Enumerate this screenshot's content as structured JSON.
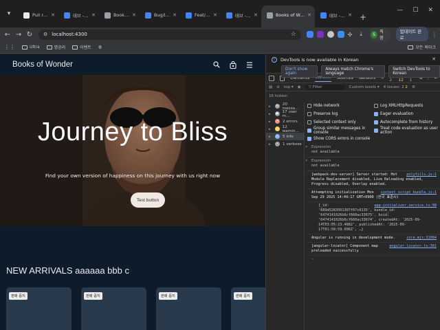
{
  "browser": {
    "tabs": [
      {
        "title": "Pull requests ·",
        "favicon_color": "#e8eaed",
        "active": false
      },
      {
        "title": "태브 - Tesso",
        "favicon_color": "#4285f4",
        "active": false
      },
      {
        "title": "Books of Wond",
        "favicon_color": "#9aa0a6",
        "active": false
      },
      {
        "title": "Bug/Issue Track",
        "favicon_color": "#4285f4",
        "active": false
      },
      {
        "title": "Feat/bens cova",
        "favicon_color": "#4285f4",
        "active": false
      },
      {
        "title": "태브 - Tesso",
        "favicon_color": "#4285f4",
        "active": false
      },
      {
        "title": "Books of Wond",
        "favicon_color": "#9aa0a6",
        "active": true
      },
      {
        "title": "태브 - Tesso",
        "favicon_color": "#4285f4",
        "active": false
      }
    ],
    "url": "localhost:4300",
    "profile_name": "직장",
    "update_label": "업데이트 완료",
    "bookmarks": [
      {
        "label": "Ultra",
        "type": "folder"
      },
      {
        "label": "명공리",
        "type": "folder"
      },
      {
        "label": "이벤트",
        "type": "folder"
      },
      {
        "label": "",
        "type": "globe"
      }
    ],
    "bookmarks_all": "모든 북마크"
  },
  "site": {
    "brand": "Books of Wonder",
    "hero": {
      "title": "Journey to Bliss",
      "subtitle": "Find your own version of happiness on this journey with us right now",
      "button": "Test button"
    },
    "section_title": "NEW ARRIVALS aaaaaa bbb c",
    "cards": [
      {
        "badge": "판매 중지"
      },
      {
        "badge": "판매 중지"
      },
      {
        "badge": "판매 중지"
      },
      {
        "badge": "판매 중지"
      }
    ]
  },
  "devtools": {
    "banner": "DevTools is now available in Korean",
    "banner_buttons": [
      "Don't show again",
      "Always match Chrome's language",
      "Switch DevTools to Korean"
    ],
    "tabs": [
      "Elements",
      "Console",
      "Sources",
      "Network"
    ],
    "active_tab": "Console",
    "counts": {
      "errors": "2",
      "warnings": "12",
      "info": "1"
    },
    "top_label": "top",
    "filter_placeholder": "Filter",
    "levels_label": "Custom levels",
    "issues_label": "4 Issues:",
    "issues_errors": "2",
    "issues_warnings": "2",
    "hidden_label": "16 hidden",
    "sidebar": [
      {
        "label": "20 messa…",
        "icon": "list",
        "color": "#9aa0a6",
        "selected": false
      },
      {
        "label": "17 user m…",
        "icon": "user",
        "color": "#9aa0a6",
        "selected": false
      },
      {
        "label": "2 errors",
        "icon": "error",
        "color": "#f28b82",
        "selected": false
      },
      {
        "label": "12 warnin…",
        "icon": "warning",
        "color": "#fdd663",
        "selected": false
      },
      {
        "label": "5 info",
        "icon": "info",
        "color": "#8ab4f8",
        "selected": true
      },
      {
        "label": "1 verbose",
        "icon": "verbose",
        "color": "#9aa0a6",
        "selected": false
      }
    ],
    "settings": [
      {
        "label": "Hide network",
        "checked": false
      },
      {
        "label": "Log XMLHttpRequests",
        "checked": false
      },
      {
        "label": "Preserve log",
        "checked": false
      },
      {
        "label": "Eager evaluation",
        "checked": true
      },
      {
        "label": "Selected context only",
        "checked": false
      },
      {
        "label": "Autocomplete from history",
        "checked": true
      },
      {
        "label": "Group similar messages in console",
        "checked": true
      },
      {
        "label": "Treat code evaluation as user action",
        "checked": true
      },
      {
        "label": "Show CORS errors in console",
        "checked": true
      }
    ],
    "expressions": [
      {
        "label": "Expression",
        "value": "not available"
      },
      {
        "label": "Expression",
        "value": "not available"
      }
    ],
    "logs": [
      {
        "text": "[webpack-dev-server] Server started: Hot Module Replacement disabled, Live Reloading enabled, Progress disabled, Overlay enabled.",
        "source": "polyfills.js:1"
      },
      {
        "text": "Attempting initialization Mon Sep 29 2025 14:49:17 GMT+0900 (한국 표준시)",
        "source": "content_script_bundle.js:1"
      },
      {
        "text": "",
        "source": "app-initializer.service.ts:98"
      },
      {
        "text": "Angular is running in development mode.",
        "source": "core.mjs:31084"
      },
      {
        "text": "[angular-locator] Component map preloaded successfully",
        "source": "angular-locator.ts:361"
      }
    ],
    "object_dump": "{_id: '689d5283501307f07c0135', bundle_id: '6474141026b6cf660ac33675', bsid: '6474141026b6cf660ac33674', createdAt: '2025-09-14T03:05:23.4882', publishedAt: '2025-09-17T01:58:59.096Z', …}"
  }
}
